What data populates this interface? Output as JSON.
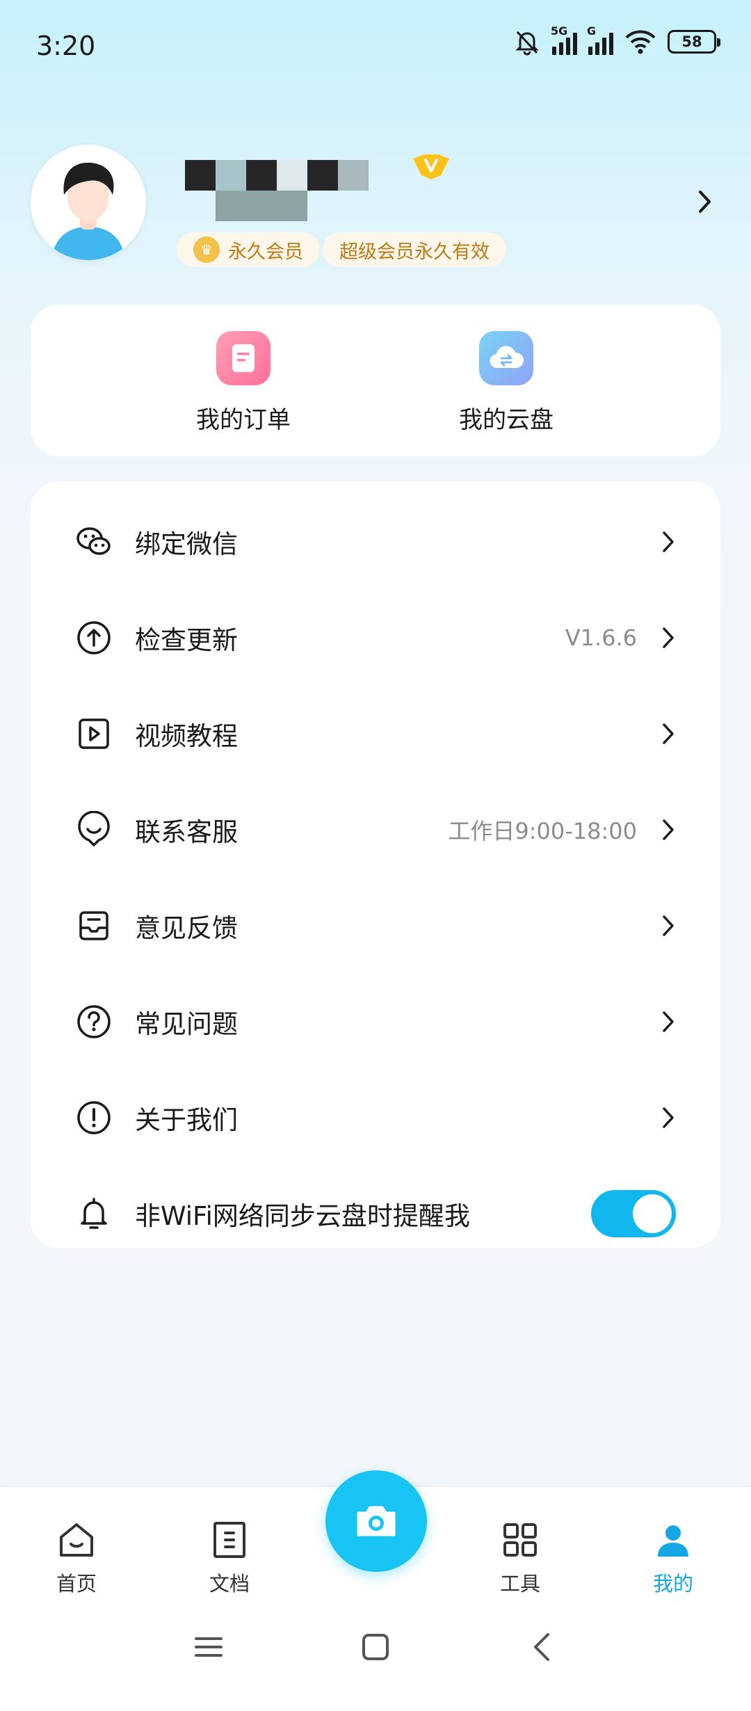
{
  "status_bar": {
    "time": "3:20",
    "network_5g": "5G",
    "network_g": "G",
    "battery": "58"
  },
  "profile": {
    "username_note": "",
    "badges": {
      "member": "永久会员",
      "super_member": "超级会员永久有效"
    }
  },
  "quick_actions": [
    {
      "label": "我的订单",
      "icon": "order-icon"
    },
    {
      "label": "我的云盘",
      "icon": "cloud-disk-icon"
    }
  ],
  "menu": [
    {
      "label": "绑定微信",
      "value": "",
      "icon": "wechat-icon"
    },
    {
      "label": "检查更新",
      "value": "V1.6.6",
      "icon": "upload-circle-icon"
    },
    {
      "label": "视频教程",
      "value": "",
      "icon": "video-icon"
    },
    {
      "label": "联系客服",
      "value": "工作日9:00-18:00",
      "icon": "customer-service-icon"
    },
    {
      "label": "意见反馈",
      "value": "",
      "icon": "feedback-icon"
    },
    {
      "label": "常见问题",
      "value": "",
      "icon": "question-icon"
    },
    {
      "label": "关于我们",
      "value": "",
      "icon": "info-icon"
    }
  ],
  "wifi_toggle": {
    "label": "非WiFi网络同步云盘时提醒我",
    "enabled": true,
    "icon": "bell-icon"
  },
  "bottom_nav": {
    "items": [
      {
        "label": "首页",
        "icon": "home-icon",
        "active": false
      },
      {
        "label": "文档",
        "icon": "document-icon",
        "active": false
      },
      {
        "label": "工具",
        "icon": "grid-icon",
        "active": false
      },
      {
        "label": "我的",
        "icon": "person-icon",
        "active": true
      }
    ],
    "camera_icon": "camera-icon"
  },
  "colors": {
    "accent": "#15a6e6",
    "toggle": "#12b6ee",
    "camera": "#18c4f3",
    "badge_text": "#c07a16"
  }
}
